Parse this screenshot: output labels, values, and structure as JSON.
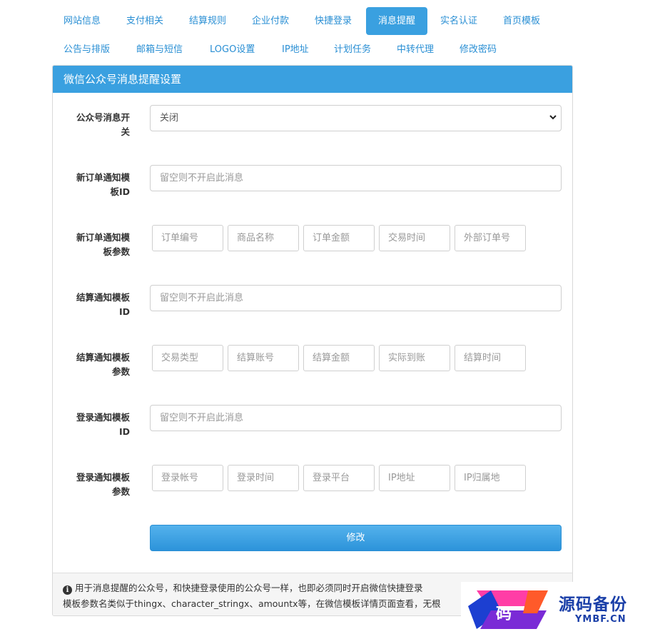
{
  "tabs": [
    {
      "label": "网站信息",
      "active": false
    },
    {
      "label": "支付相关",
      "active": false
    },
    {
      "label": "结算规则",
      "active": false
    },
    {
      "label": "企业付款",
      "active": false
    },
    {
      "label": "快捷登录",
      "active": false
    },
    {
      "label": "消息提醒",
      "active": true
    },
    {
      "label": "实名认证",
      "active": false
    },
    {
      "label": "首页模板",
      "active": false
    },
    {
      "label": "公告与排版",
      "active": false
    },
    {
      "label": "邮箱与短信",
      "active": false
    },
    {
      "label": "LOGO设置",
      "active": false
    },
    {
      "label": "IP地址",
      "active": false
    },
    {
      "label": "计划任务",
      "active": false
    },
    {
      "label": "中转代理",
      "active": false
    },
    {
      "label": "修改密码",
      "active": false
    }
  ],
  "panel": {
    "title": "微信公众号消息提醒设置",
    "switch": {
      "label_line1": "公众号消息开",
      "label_line2": "关",
      "value": "关闭"
    },
    "order_template": {
      "label_line1": "新订单通知模",
      "label_line2": "板ID",
      "placeholder": "留空则不开启此消息"
    },
    "order_params": {
      "label_line1": "新订单通知模",
      "label_line2": "板参数",
      "placeholders": [
        "订单编号",
        "商品名称",
        "订单金额",
        "交易时间",
        "外部订单号"
      ]
    },
    "settle_template": {
      "label_line1": "结算通知模板",
      "label_line2": "ID",
      "placeholder": "留空则不开启此消息"
    },
    "settle_params": {
      "label_line1": "结算通知模板",
      "label_line2": "参数",
      "placeholders": [
        "交易类型",
        "结算账号",
        "结算金额",
        "实际到账",
        "结算时间"
      ]
    },
    "login_template": {
      "label_line1": "登录通知模板",
      "label_line2": "ID",
      "placeholder": "留空则不开启此消息"
    },
    "login_params": {
      "label_line1": "登录通知模板",
      "label_line2": "参数",
      "placeholders": [
        "登录帐号",
        "登录时间",
        "登录平台",
        "IP地址",
        "IP归属地"
      ]
    },
    "submit_label": "修改",
    "footer_line1": "用于消息提醒的公众号，和快捷登录使用的公众号一样，也即必须同时开启微信快捷登录",
    "footer_line2": "模板参数名类似于thingx、character_stringx、amountx等，在微信模板详情页面查看，无根"
  },
  "watermark": {
    "text": "源码备份",
    "sub": "YMBF.CN",
    "badge": "码"
  },
  "colors": {
    "accent": "#3aa0e0",
    "link": "#2a8fd4"
  }
}
